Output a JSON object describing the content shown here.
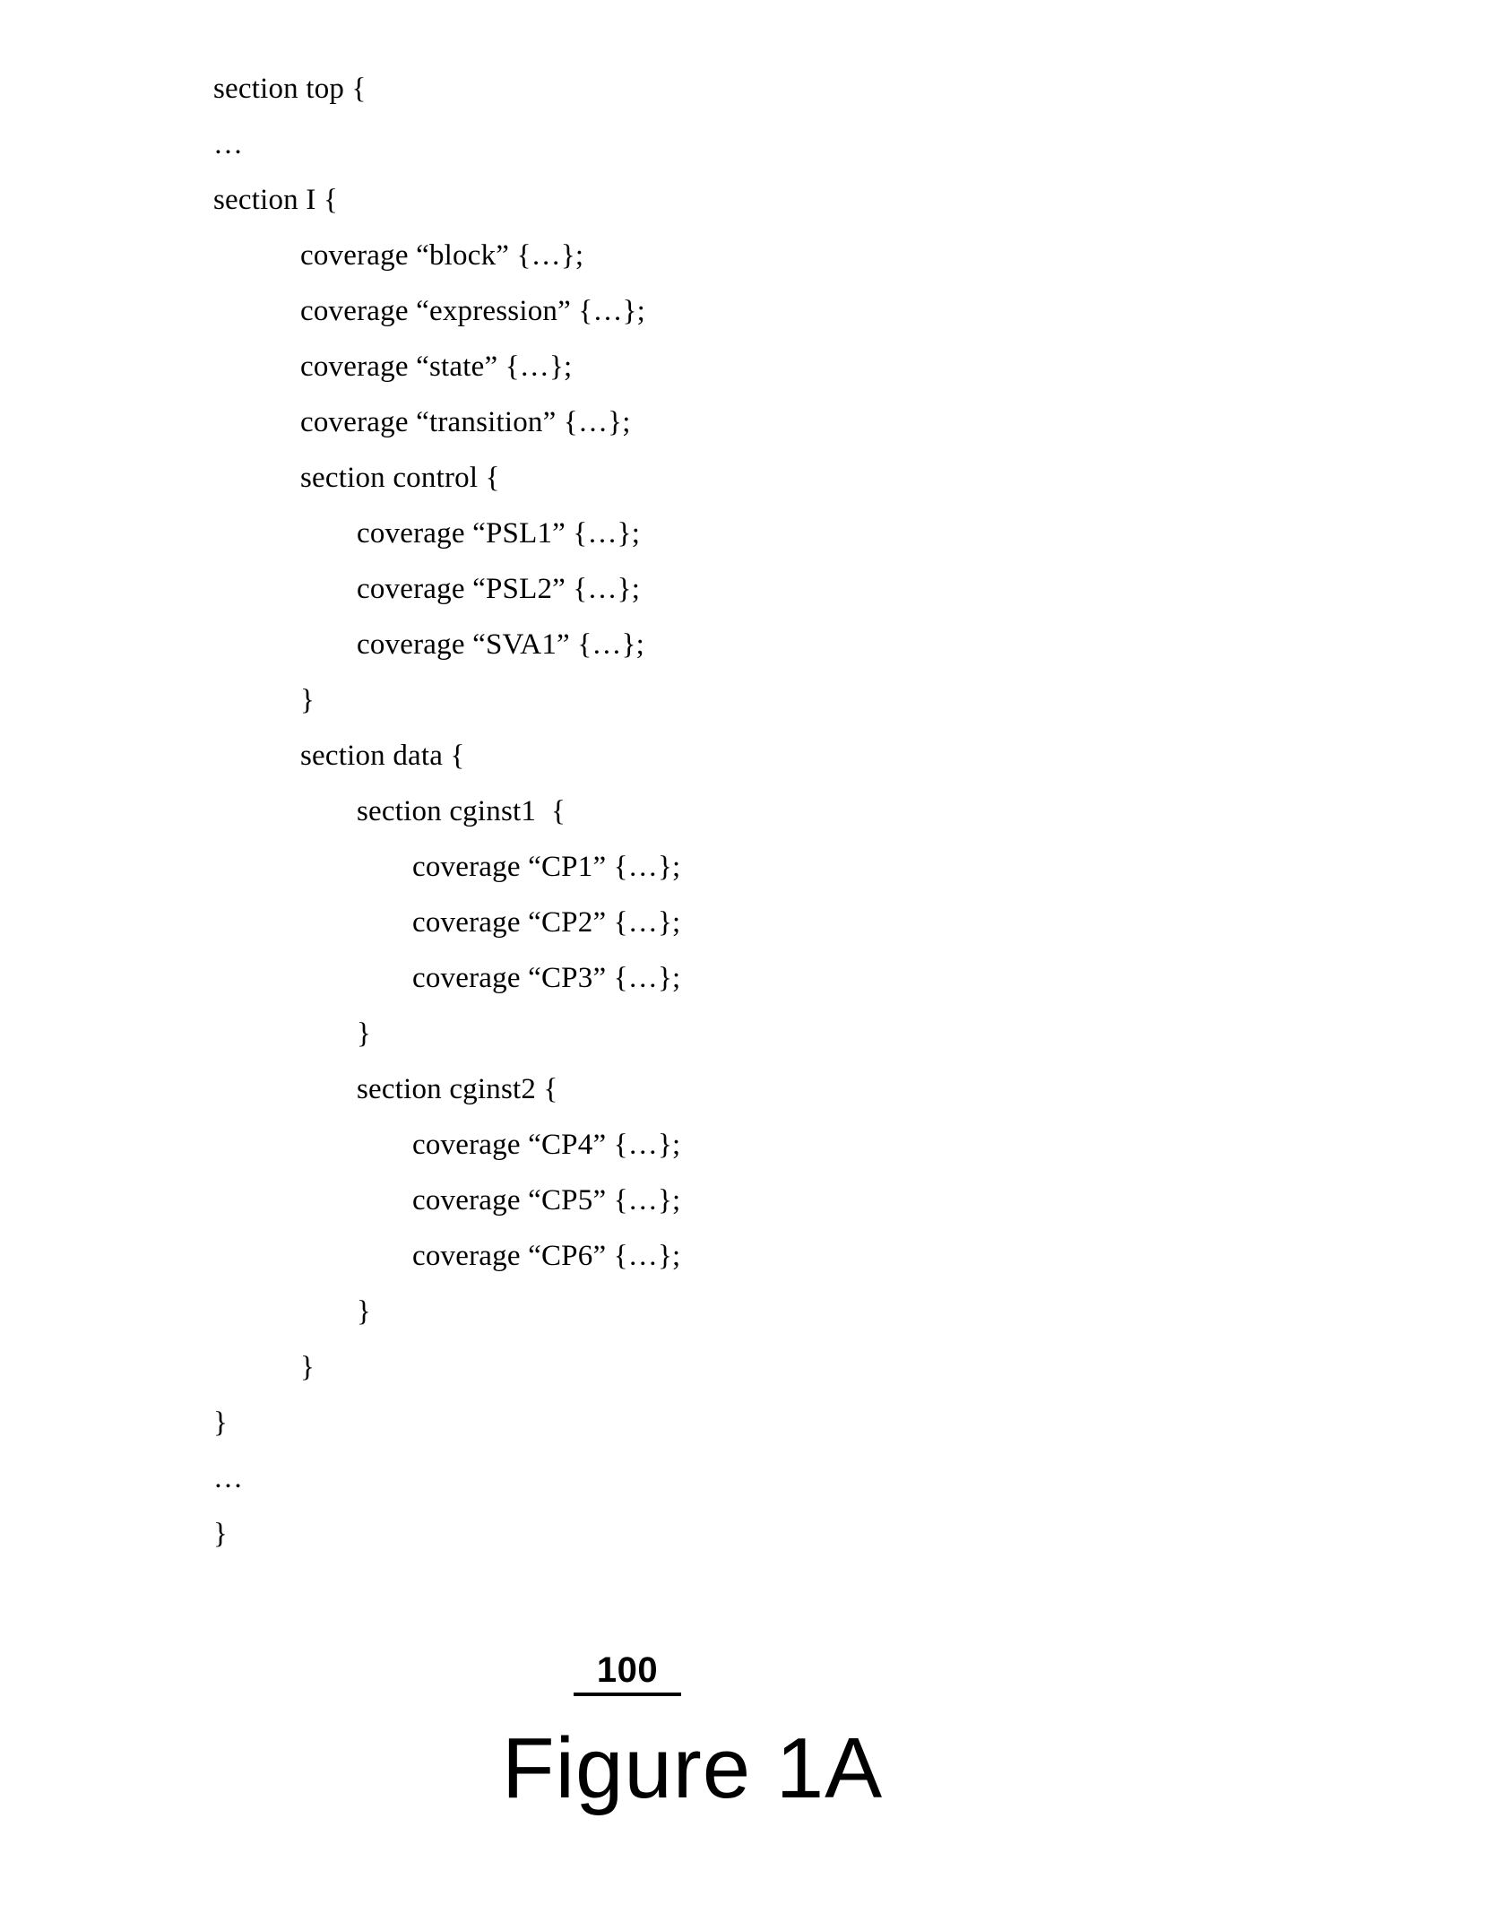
{
  "figure": {
    "reference_numeral": "100",
    "caption": "Figure 1A"
  },
  "code": {
    "lines": [
      {
        "indent": 0,
        "text": "section top {"
      },
      {
        "indent": 0,
        "text": "…"
      },
      {
        "indent": 0,
        "text": "section I {"
      },
      {
        "indent": 1,
        "text": "coverage “block” {…};"
      },
      {
        "indent": 1,
        "text": "coverage “expression” {…};"
      },
      {
        "indent": 1,
        "text": "coverage “state” {…};"
      },
      {
        "indent": 1,
        "text": "coverage “transition” {…};"
      },
      {
        "indent": 1,
        "text": "section control {"
      },
      {
        "indent": 2,
        "text": "coverage “PSL1” {…};"
      },
      {
        "indent": 2,
        "text": "coverage “PSL2” {…};"
      },
      {
        "indent": 2,
        "text": "coverage “SVA1” {…};"
      },
      {
        "indent": 1,
        "text": "}"
      },
      {
        "indent": 1,
        "text": "section data {"
      },
      {
        "indent": 2,
        "text": "section cginst1  {"
      },
      {
        "indent": 3,
        "text": "coverage “CP1” {…};"
      },
      {
        "indent": 3,
        "text": "coverage “CP2” {…};"
      },
      {
        "indent": 3,
        "text": "coverage “CP3” {…};"
      },
      {
        "indent": 2,
        "text": "}"
      },
      {
        "indent": 2,
        "text": "section cginst2 {"
      },
      {
        "indent": 3,
        "text": "coverage “CP4” {…};"
      },
      {
        "indent": 3,
        "text": "coverage “CP5” {…};"
      },
      {
        "indent": 3,
        "text": "coverage “CP6” {…};"
      },
      {
        "indent": 2,
        "text": "}"
      },
      {
        "indent": 1,
        "text": "}"
      },
      {
        "indent": 0,
        "text": "}"
      },
      {
        "indent": 0,
        "text": "…"
      },
      {
        "indent": 0,
        "text": "}"
      }
    ]
  }
}
